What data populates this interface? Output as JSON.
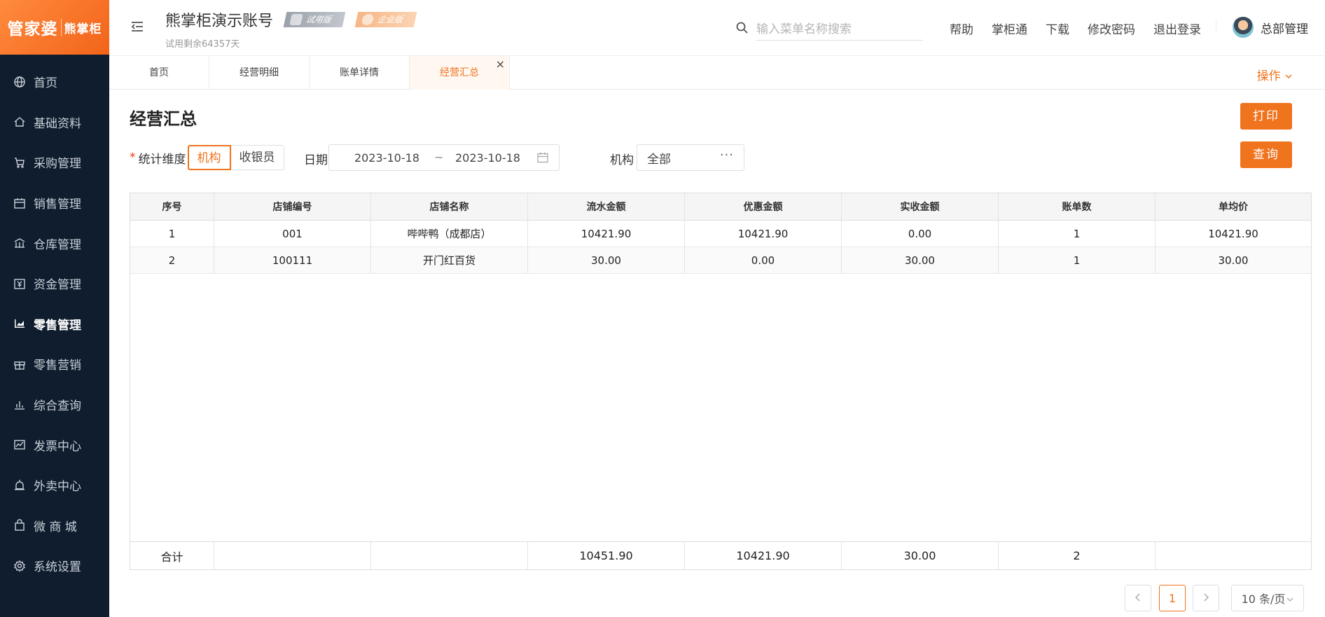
{
  "sidebar": {
    "logo_main": "管家婆",
    "logo_sub": "熊掌柜",
    "items": [
      {
        "label": "首页",
        "icon": "globe-icon"
      },
      {
        "label": "基础资料",
        "icon": "home-icon"
      },
      {
        "label": "采购管理",
        "icon": "cart-icon"
      },
      {
        "label": "销售管理",
        "icon": "calendar-icon"
      },
      {
        "label": "仓库管理",
        "icon": "warehouse-icon"
      },
      {
        "label": "资金管理",
        "icon": "yuan-icon"
      },
      {
        "label": "零售管理",
        "icon": "chart-icon"
      },
      {
        "label": "零售营销",
        "icon": "gift-icon"
      },
      {
        "label": "综合查询",
        "icon": "bar-chart-icon"
      },
      {
        "label": "发票中心",
        "icon": "line-chart-icon"
      },
      {
        "label": "外卖中心",
        "icon": "alarm-icon"
      },
      {
        "label": "微 商 城",
        "icon": "bag-icon"
      },
      {
        "label": "系统设置",
        "icon": "gear-icon"
      }
    ],
    "active_index": 6
  },
  "header": {
    "account_title": "熊掌柜演示账号",
    "trial_badge": "试用版",
    "enterprise_badge": "企业版",
    "trial_remaining": "试用剩余64357天",
    "search_placeholder": "输入菜单名称搜索",
    "links": [
      "帮助",
      "掌柜通",
      "下载",
      "修改密码",
      "退出登录"
    ],
    "user_name": "总部管理"
  },
  "tabs": [
    {
      "label": "首页"
    },
    {
      "label": "经营明细"
    },
    {
      "label": "账单详情"
    },
    {
      "label": "经营汇总"
    }
  ],
  "active_tab": "经营汇总",
  "tab_close": "×",
  "ops_label": "操作",
  "page": {
    "title": "经营汇总",
    "print_button": "打印",
    "query_button": "查询"
  },
  "filters": {
    "dimension_label": "统计维度",
    "dimension_options": [
      "机构",
      "收银员"
    ],
    "dimension_selected": "机构",
    "date_label": "日期",
    "date_from": "2023-10-18",
    "date_sep": "~",
    "date_to": "2023-10-18",
    "org_label": "机构",
    "org_value": "全部",
    "org_more": "···"
  },
  "table": {
    "columns": [
      "序号",
      "店铺编号",
      "店铺名称",
      "流水金额",
      "优惠金额",
      "实收金额",
      "账单数",
      "单均价"
    ],
    "rows": [
      [
        "1",
        "001",
        "哔哔鸭（成都店）",
        "10421.90",
        "10421.90",
        "0.00",
        "1",
        "10421.90"
      ],
      [
        "2",
        "100111",
        "开门红百货",
        "30.00",
        "0.00",
        "30.00",
        "1",
        "30.00"
      ]
    ],
    "footer": [
      "合计",
      "",
      "",
      "10451.90",
      "10421.90",
      "30.00",
      "2",
      ""
    ]
  },
  "pagination": {
    "current_page": "1",
    "page_size": "10 条/页"
  },
  "colors": {
    "accent": "#f0731e",
    "sidebar_bg": "#0f1d2e"
  }
}
